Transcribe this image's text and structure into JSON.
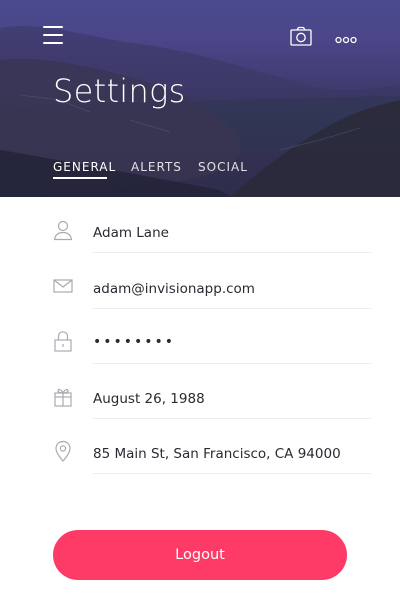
{
  "header": {
    "title": "Settings",
    "icons": {
      "menu": "hamburger-menu-icon",
      "camera": "camera-icon",
      "more": "more-options-icon"
    },
    "tabs": [
      {
        "label": "GENERAL",
        "active": true
      },
      {
        "label": "ALERTS",
        "active": false
      },
      {
        "label": "SOCIAL",
        "active": false
      }
    ]
  },
  "fields": [
    {
      "icon": "user-icon",
      "value": "Adam Lane"
    },
    {
      "icon": "mail-icon",
      "value": "adam@invisionapp.com"
    },
    {
      "icon": "lock-icon",
      "value": "••••••••"
    },
    {
      "icon": "gift-icon",
      "value": "August 26, 1988"
    },
    {
      "icon": "location-pin-icon",
      "value": "85 Main St, San Francisco, CA 94000"
    }
  ],
  "logout": {
    "label": "Logout"
  },
  "colors": {
    "header_top": "#4a4a8e",
    "header_bottom": "#1f2233",
    "accent": "#fe3a67",
    "text": "#2a2a33",
    "icon_gray": "#a9a9b2",
    "divider": "#ededf0"
  }
}
